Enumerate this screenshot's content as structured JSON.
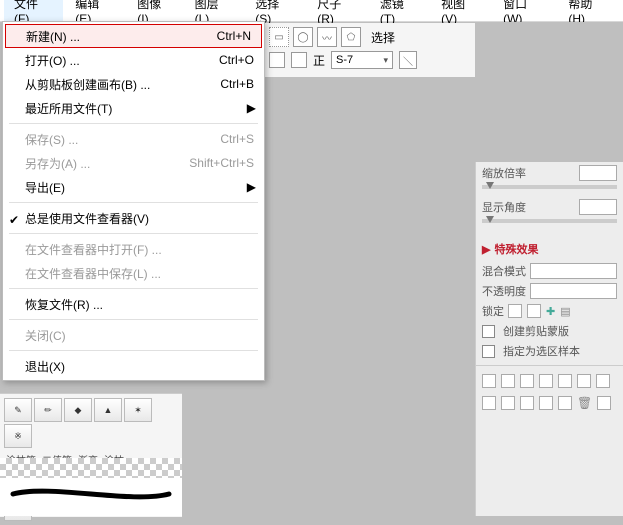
{
  "menubar": [
    {
      "label": "文件",
      "accel": "F",
      "open": true
    },
    {
      "label": "编辑",
      "accel": "E"
    },
    {
      "label": "图像",
      "accel": "I"
    },
    {
      "label": "图层",
      "accel": "L"
    },
    {
      "label": "选择",
      "accel": "S"
    },
    {
      "label": "尺子",
      "accel": "R"
    },
    {
      "label": "滤镜",
      "accel": "T"
    },
    {
      "label": "视图",
      "accel": "V"
    },
    {
      "label": "窗口",
      "accel": "W"
    },
    {
      "label": "帮助",
      "accel": "H"
    }
  ],
  "fileMenu": [
    {
      "type": "item",
      "label": "新建(N) ...",
      "shortcut": "Ctrl+N",
      "highlight": true
    },
    {
      "type": "item",
      "label": "打开(O) ...",
      "shortcut": "Ctrl+O"
    },
    {
      "type": "item",
      "label": "从剪贴板创建画布(B) ...",
      "shortcut": "Ctrl+B"
    },
    {
      "type": "item",
      "label": "最近所用文件(T)",
      "submenu": true
    },
    {
      "type": "sep"
    },
    {
      "type": "item",
      "label": "保存(S) ...",
      "shortcut": "Ctrl+S",
      "disabled": true
    },
    {
      "type": "item",
      "label": "另存为(A) ...",
      "shortcut": "Shift+Ctrl+S",
      "disabled": true
    },
    {
      "type": "item",
      "label": "导出(E)",
      "submenu": true
    },
    {
      "type": "sep"
    },
    {
      "type": "item",
      "label": "总是使用文件查看器(V)",
      "checked": true
    },
    {
      "type": "sep"
    },
    {
      "type": "item",
      "label": "在文件查看器中打开(F) ...",
      "disabled": true
    },
    {
      "type": "item",
      "label": "在文件查看器中保存(L) ...",
      "disabled": true
    },
    {
      "type": "sep"
    },
    {
      "type": "item",
      "label": "恢复文件(R) ..."
    },
    {
      "type": "sep"
    },
    {
      "type": "item",
      "label": "关闭(C)",
      "disabled": true
    },
    {
      "type": "sep"
    },
    {
      "type": "item",
      "label": "退出(X)"
    }
  ],
  "optbar": {
    "selectLabel": "选择",
    "widthLabel": "正",
    "preset": "S-7"
  },
  "right": {
    "zoomLabel": "缩放倍率",
    "angleLabel": "显示角度",
    "fxTitle": "特殊效果",
    "blendLabel": "混合模式",
    "opacityLabel": "不透明度",
    "lockLabel": "锁定",
    "clipLabel": "创建剪贴蒙版",
    "selSampleLabel": "指定为选区样本"
  },
  "tools": {
    "rowLabels": [
      "涂抹笔",
      "二值笔",
      "渐变",
      "涂抹"
    ]
  }
}
